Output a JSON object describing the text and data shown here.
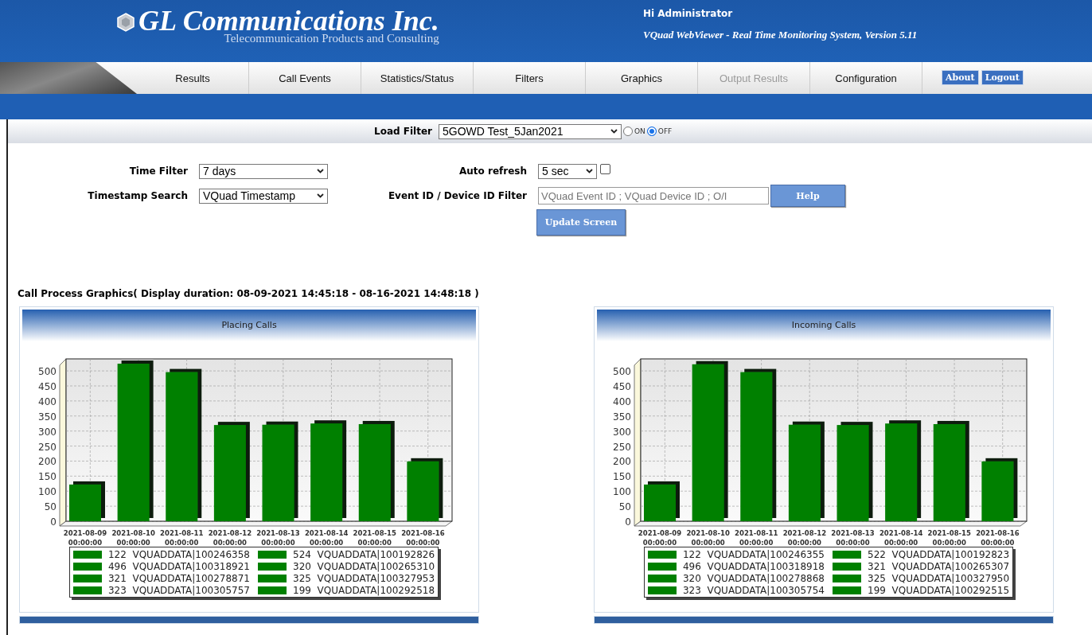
{
  "header": {
    "company": "GL Communications Inc.",
    "tagline": "Telecommunication Products and Consulting",
    "greeting": "Hi Administrator",
    "product": "VQuad WebViewer - Real Time Monitoring System, Version 5.11"
  },
  "nav": {
    "tabs": [
      {
        "label": "Results",
        "disabled": false
      },
      {
        "label": "Call Events",
        "disabled": false
      },
      {
        "label": "Statistics/Status",
        "disabled": false
      },
      {
        "label": "Filters",
        "disabled": false
      },
      {
        "label": "Graphics",
        "disabled": false
      },
      {
        "label": "Output Results",
        "disabled": true
      },
      {
        "label": "Configuration",
        "disabled": false
      }
    ],
    "buttons": [
      "About",
      "Logout"
    ]
  },
  "load_filter": {
    "label": "Load Filter",
    "value": "5GOWD Test_5Jan2021",
    "options": [
      {
        "label": "ON",
        "selected": false
      },
      {
        "label": "OFF",
        "selected": true
      }
    ]
  },
  "form": {
    "time_filter": {
      "label": "Time Filter",
      "value": "7 days"
    },
    "timestamp_search": {
      "label": "Timestamp Search",
      "value": "VQuad Timestamp"
    },
    "auto_refresh": {
      "label": "Auto refresh",
      "value": "5 sec",
      "checked": false
    },
    "id_filter": {
      "label": "Event ID / Device ID Filter",
      "placeholder": "VQuad Event ID ; VQuad Device ID ; O/I"
    },
    "help_button": "Help",
    "update_button": "Update Screen"
  },
  "caption": "Call Process Graphics( Display duration: 08-09-2021 14:45:18 - 08-16-2021 14:48:18 )",
  "charts": [
    {
      "chart_data": {
        "type": "bar",
        "title": "Placing Calls",
        "grid": true,
        "categories": [
          "2021-08-09 00:00:00",
          "2021-08-10 00:00:00",
          "2021-08-11 00:00:00",
          "2021-08-12 00:00:00",
          "2021-08-13 00:00:00",
          "2021-08-14 00:00:00",
          "2021-08-15 00:00:00",
          "2021-08-16 00:00:00"
        ],
        "series": [
          {
            "color": "#008000",
            "values": [
              122,
              524,
              496,
              320,
              321,
              325,
              323,
              199
            ]
          }
        ],
        "ylim": [
          0,
          540
        ],
        "yticks": [
          0,
          50,
          100,
          150,
          200,
          250,
          300,
          350,
          400,
          450,
          500
        ]
      },
      "legend": [
        "122  VQUADDATA|100246358",
        "524  VQUADDATA|100192826",
        "496  VQUADDATA|100318921",
        "320  VQUADDATA|100265310",
        "321  VQUADDATA|100278871",
        "325  VQUADDATA|100327953",
        "323  VQUADDATA|100305757",
        "199  VQUADDATA|100292518"
      ]
    },
    {
      "chart_data": {
        "type": "bar",
        "title": "Incoming Calls",
        "grid": true,
        "categories": [
          "2021-08-09 00:00:00",
          "2021-08-10 00:00:00",
          "2021-08-11 00:00:00",
          "2021-08-12 00:00:00",
          "2021-08-13 00:00:00",
          "2021-08-14 00:00:00",
          "2021-08-15 00:00:00",
          "2021-08-16 00:00:00"
        ],
        "series": [
          {
            "color": "#008000",
            "values": [
              122,
              522,
              496,
              321,
              320,
              325,
              323,
              199
            ]
          }
        ],
        "ylim": [
          0,
          540
        ],
        "yticks": [
          0,
          50,
          100,
          150,
          200,
          250,
          300,
          350,
          400,
          450,
          500
        ]
      },
      "legend": [
        "122  VQUADDATA|100246355",
        "522  VQUADDATA|100192823",
        "496  VQUADDATA|100318918",
        "321  VQUADDATA|100265307",
        "320  VQUADDATA|100278868",
        "325  VQUADDATA|100327950",
        "323  VQUADDATA|100305754",
        "199  VQUADDATA|100292515"
      ]
    }
  ]
}
